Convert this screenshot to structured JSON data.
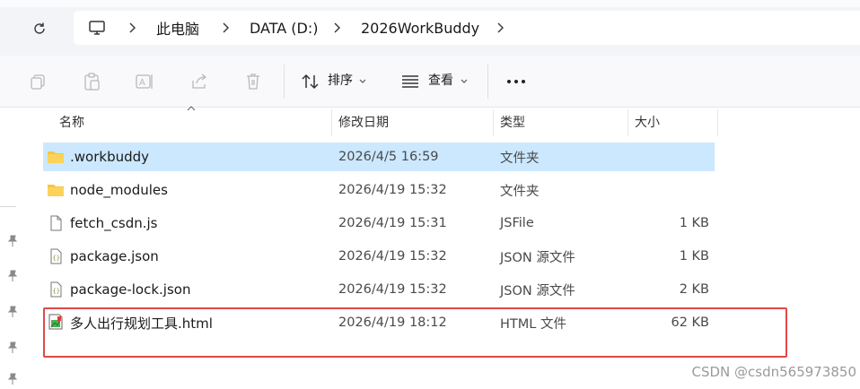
{
  "breadcrumb": {
    "items": [
      "此电脑",
      "DATA (D:)",
      "2026WorkBuddy"
    ]
  },
  "toolbar": {
    "sort_label": "排序",
    "view_label": "查看",
    "more_label": "···"
  },
  "columns": {
    "name": "名称",
    "modified": "修改日期",
    "type": "类型",
    "size": "大小"
  },
  "files": [
    {
      "name": ".workbuddy",
      "modified": "2026/4/5 16:59",
      "type": "文件夹",
      "size": "",
      "icon": "folder-icon",
      "selected": true
    },
    {
      "name": "node_modules",
      "modified": "2026/4/19 15:32",
      "type": "文件夹",
      "size": "",
      "icon": "folder-icon",
      "selected": false
    },
    {
      "name": "fetch_csdn.js",
      "modified": "2026/4/19 15:31",
      "type": "JSFile",
      "size": "1 KB",
      "icon": "file-icon",
      "selected": false
    },
    {
      "name": "package.json",
      "modified": "2026/4/19 15:32",
      "type": "JSON 源文件",
      "size": "1 KB",
      "icon": "json-file-icon",
      "selected": false
    },
    {
      "name": "package-lock.json",
      "modified": "2026/4/19 15:32",
      "type": "JSON 源文件",
      "size": "2 KB",
      "icon": "json-file-icon",
      "selected": false
    },
    {
      "name": "多人出行规划工具.html",
      "modified": "2026/4/19 18:12",
      "type": "HTML 文件",
      "size": "62 KB",
      "icon": "html-file-icon",
      "selected": false
    }
  ],
  "watermark": "CSDN @csdn565973850",
  "colors": {
    "selection": "#cce8ff",
    "highlight_box": "#e04848",
    "folder": "#f5c542"
  }
}
